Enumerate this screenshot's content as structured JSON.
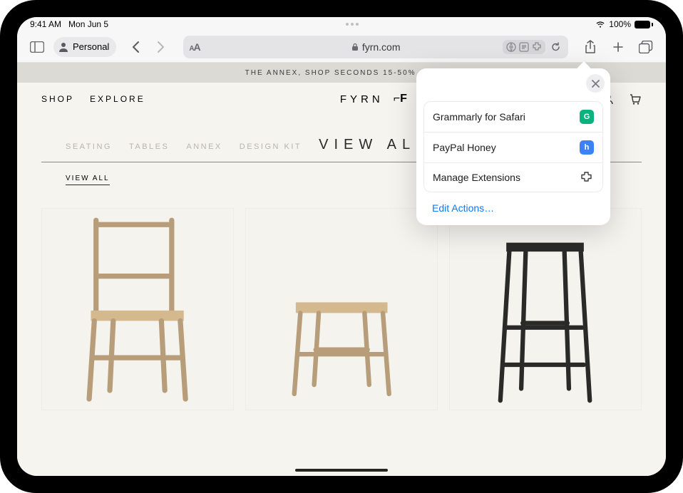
{
  "status": {
    "time": "9:41 AM",
    "date": "Mon Jun 5",
    "battery": "100%"
  },
  "safari": {
    "profile_label": "Personal",
    "addr_text_size": "AA",
    "addr_domain": "fyrn.com"
  },
  "page": {
    "promo": "THE ANNEX, SHOP SECONDS 15-50% OFF",
    "nav_shop": "SHOP",
    "nav_explore": "EXPLORE",
    "brand": "FYRN",
    "subnav": {
      "seating": "SEATING",
      "tables": "TABLES",
      "annex": "ANNEX",
      "designkit": "DESIGN KIT",
      "viewall_title": "VIEW ALL"
    },
    "viewall_link": "VIEW ALL"
  },
  "popover": {
    "items": [
      {
        "label": "Grammarly for Safari",
        "icon": "G",
        "bg": "#0ab27d",
        "fg": "#ffffff"
      },
      {
        "label": "PayPal Honey",
        "icon": "h",
        "bg": "#3b82f6",
        "fg": "#ffffff"
      }
    ],
    "manage": "Manage Extensions",
    "edit": "Edit Actions…"
  }
}
